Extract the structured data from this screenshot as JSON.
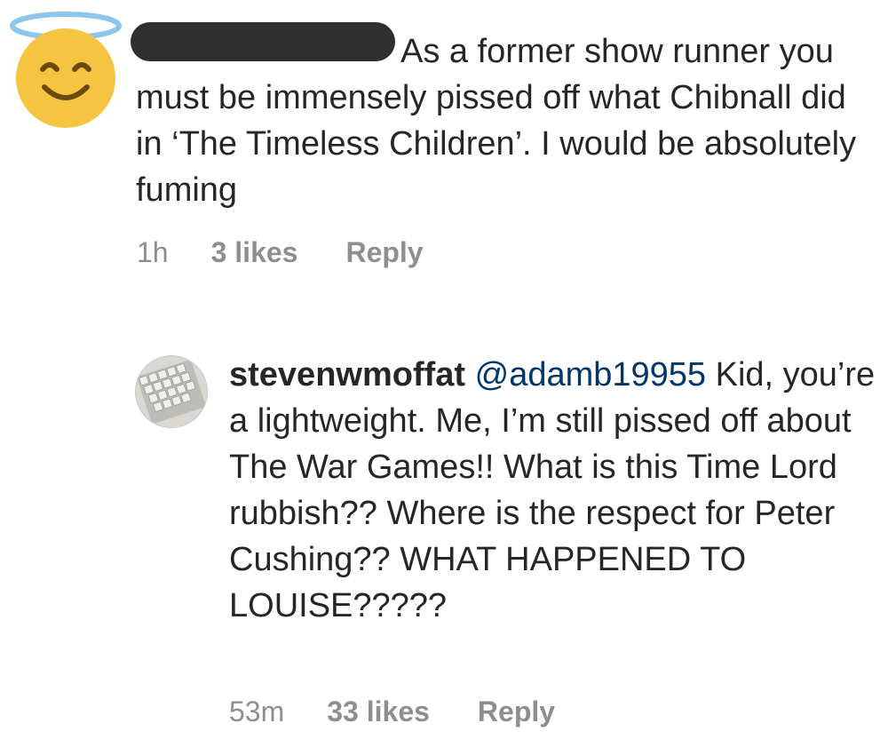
{
  "comments": [
    {
      "avatar_icon": "angel-smiley-face-icon",
      "username_redacted": true,
      "text": "As a former show runner you must be immensely pissed off what Chibnall did in ‘The Timeless Children’. I would be absolutely fuming",
      "time": "1h",
      "likes": "3 likes",
      "reply_label": "Reply"
    },
    {
      "avatar_icon": "keyboard-photo-avatar",
      "username": "stevenwmoffat",
      "mention": "@adamb19955",
      "text": " Kid, you’re a lightweight. Me, I’m still pissed off about The War Games!! What is this Time Lord rubbish?? Where is the respect for Peter Cushing?? WHAT HAPPENED TO LOUISE?????",
      "time": "53m",
      "likes": "33 likes",
      "reply_label": "Reply"
    }
  ],
  "colors": {
    "text": "#262626",
    "meta": "#8e8e8e",
    "mention": "#00376b",
    "redaction": "#2f2f2f",
    "halo": "#8ec5ea",
    "emoji_face": "#f5c441"
  }
}
